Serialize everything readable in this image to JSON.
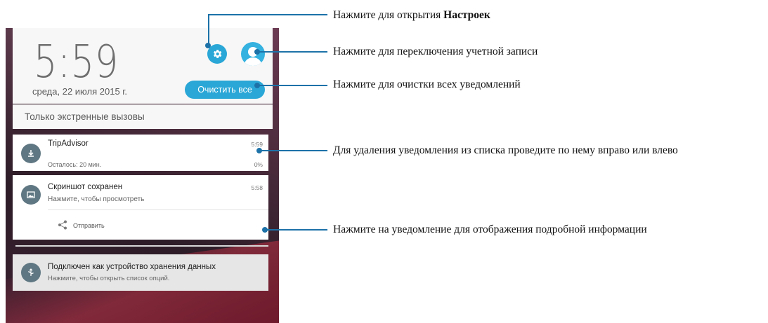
{
  "status": {
    "clock": "5:59",
    "date": "среда, 22 июля 2015 г.",
    "clear_all_label": "Очистить все"
  },
  "emergency": {
    "text": "Только экстренные вызовы"
  },
  "notifications": [
    {
      "app": "TripAdvisor",
      "sub": "Осталось: 20 мин.",
      "time": "5:59",
      "progress": "0%",
      "icon": "download-icon"
    },
    {
      "app": "Скриншот сохранен",
      "sub": "Нажмите, чтобы просмотреть",
      "time": "5:58",
      "action": "Отправить",
      "icon": "image-icon"
    },
    {
      "app": "Подключен как устройство хранения данных",
      "sub": "Нажмите, чтобы открыть список опций.",
      "icon": "usb-icon"
    }
  ],
  "callouts": {
    "settings_prefix": "Нажмите для открытия ",
    "settings_bold": "Настроек",
    "account": "Нажмите для переключения учетной записи",
    "clear": "Нажмите для очистки всех уведомлений",
    "swipe": "Для удаления уведомления из списка проведите по нему вправо или влево",
    "details": "Нажмите на уведомление для отображения подробной информации"
  },
  "colors": {
    "accent": "#2aa7d6",
    "callout": "#1d72a8"
  }
}
